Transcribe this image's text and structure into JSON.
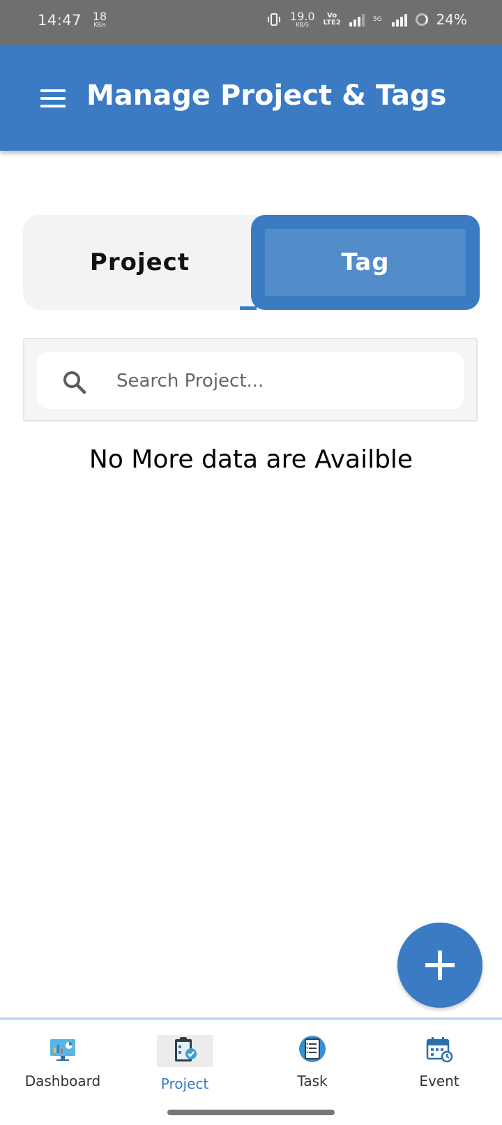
{
  "status_bar": {
    "time": "14:47",
    "net_speed_left": "18",
    "net_speed_left_unit": "KB/s",
    "net_speed_right": "19.0",
    "net_speed_right_unit": "KB/S",
    "volte_top": "Vo",
    "volte_bottom": "LTE2",
    "network_type": "5G",
    "battery": "24%"
  },
  "app_bar": {
    "title": "Manage Project & Tags",
    "menu_icon": "hamburger-menu-icon"
  },
  "segments": {
    "project_label": "Project",
    "tag_label": "Tag",
    "selected": "Tag"
  },
  "search": {
    "placeholder": "Search Project...",
    "value": ""
  },
  "empty_message": "No More data are Availble",
  "fab": {
    "icon": "plus-icon"
  },
  "bottom_nav": {
    "items": [
      {
        "label": "Dashboard",
        "icon": "dashboard-icon"
      },
      {
        "label": "Project",
        "icon": "project-clipboard-icon",
        "active": true
      },
      {
        "label": "Task",
        "icon": "task-list-icon"
      },
      {
        "label": "Event",
        "icon": "calendar-event-icon"
      }
    ]
  },
  "colors": {
    "primary": "#3a7bc4",
    "primary_light": "#528cc9",
    "status_bar": "#6f6f6f",
    "segment_inactive": "#f3f3f3"
  }
}
